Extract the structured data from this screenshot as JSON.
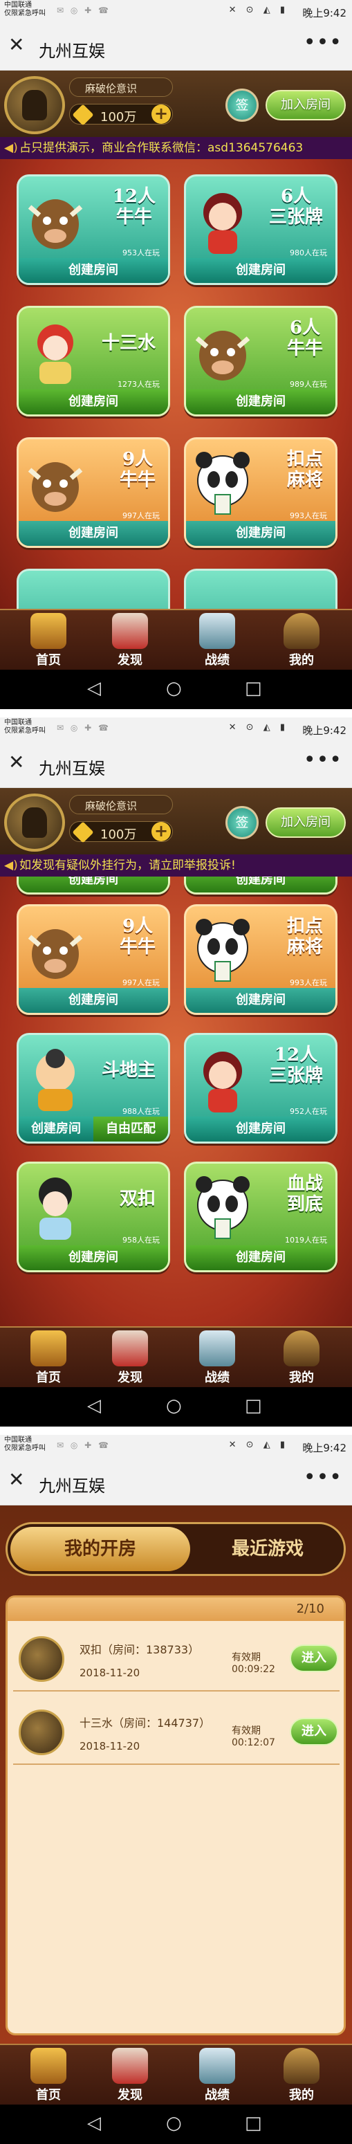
{
  "status": {
    "carrier": "中国联通\n仅限紧急呼叫",
    "time": "晚上9:42"
  },
  "wechat": {
    "title": "九州互娱",
    "close_icon": "close-icon",
    "more": "•••"
  },
  "user": {
    "name": "麻破伦意识",
    "coins": "100万"
  },
  "buttons": {
    "sign": "签",
    "join": "加入房间",
    "plus": "+"
  },
  "notices": [
    "占只提供演示，商业合作联系微信：asd1364576463",
    "如发现有疑似外挂行为，请立即举报投诉!"
  ],
  "games": [
    {
      "name": "12人\n牛牛",
      "players": "953人在玩",
      "color": "teal",
      "mascot": "bull-mascot"
    },
    {
      "name": "6人\n三张牌",
      "players": "980人在玩",
      "color": "teal",
      "mascot": "girl-mascot"
    },
    {
      "name": "十三水",
      "players": "1273人在玩",
      "color": "green",
      "mascot": "opera-mascot"
    },
    {
      "name": "6人\n牛牛",
      "players": "989人在玩",
      "color": "green",
      "mascot": "bull-mascot"
    },
    {
      "name": "9人\n牛牛",
      "players": "997人在玩",
      "color": "orange",
      "mascot": "bull-mascot"
    },
    {
      "name": "扣点\n麻将",
      "players": "993人在玩",
      "color": "orange",
      "mascot": "panda-mascot"
    },
    {
      "name": "斗地主",
      "players": "988人在玩",
      "color": "teal",
      "mascot": "landlord-mascot"
    },
    {
      "name": "12人\n三张牌",
      "players": "952人在玩",
      "color": "teal",
      "mascot": "girl-mascot"
    },
    {
      "name": "双扣",
      "players": "958人在玩",
      "color": "green",
      "mascot": "lady-mascot"
    },
    {
      "name": "血战\n到底",
      "players": "1019人在玩",
      "color": "green",
      "mascot": "panda-mascot"
    }
  ],
  "create_label": "创建房间",
  "match_label": "自由匹配",
  "nav": [
    {
      "label": "首页",
      "icon": "home-icon"
    },
    {
      "label": "发现",
      "icon": "discover-icon"
    },
    {
      "label": "战绩",
      "icon": "record-icon"
    },
    {
      "label": "我的",
      "icon": "profile-icon"
    }
  ],
  "rooms_tabs": {
    "my_rooms": "我的开房",
    "recent": "最近游戏"
  },
  "rooms_page": "2/10",
  "rooms": [
    {
      "name": "双扣（房间：138733）",
      "date": "2018-11-20",
      "valid_label": "有效期",
      "valid_time": "00:09:22",
      "enter": "进入"
    },
    {
      "name": "十三水（房间：144737）",
      "date": "2018-11-20",
      "valid_label": "有效期",
      "valid_time": "00:12:07",
      "enter": "进入"
    }
  ],
  "colors": {
    "notice_text": "#f0e050",
    "notice_bg": "#3b0d4a",
    "teal": "#1f9c86",
    "green": "#48a22a",
    "orange": "#e2872c"
  }
}
